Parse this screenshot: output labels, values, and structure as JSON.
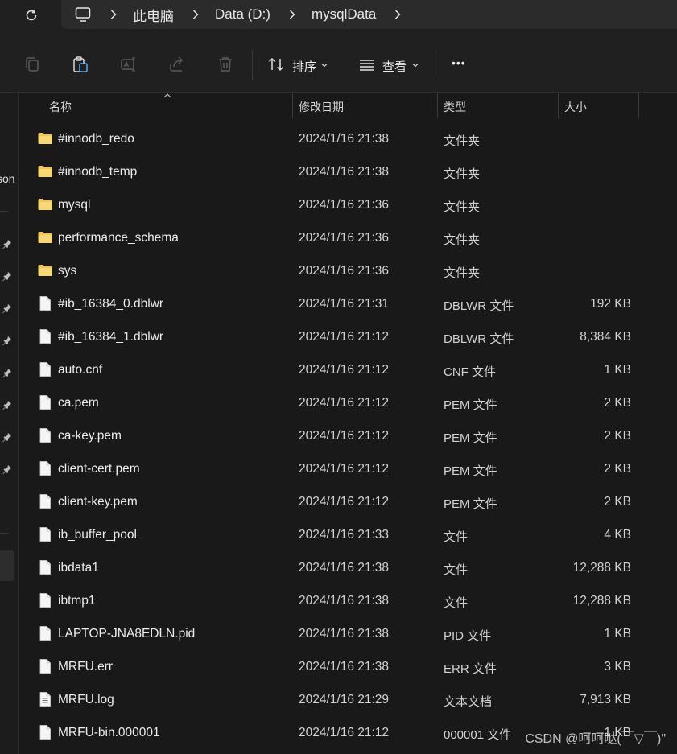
{
  "address": {
    "crumbs": [
      "此电脑",
      "Data (D:)",
      "mysqlData"
    ]
  },
  "toolbar": {
    "sort_label": "排序",
    "view_label": "查看",
    "more_label": "•••"
  },
  "nav": {
    "fragment": "son"
  },
  "columns": {
    "name": "名称",
    "date": "修改日期",
    "type": "类型",
    "size": "大小"
  },
  "files": [
    {
      "name": "#innodb_redo",
      "date": "2024/1/16 21:38",
      "type": "文件夹",
      "size": "",
      "kind": "folder"
    },
    {
      "name": "#innodb_temp",
      "date": "2024/1/16 21:38",
      "type": "文件夹",
      "size": "",
      "kind": "folder"
    },
    {
      "name": "mysql",
      "date": "2024/1/16 21:36",
      "type": "文件夹",
      "size": "",
      "kind": "folder"
    },
    {
      "name": "performance_schema",
      "date": "2024/1/16 21:36",
      "type": "文件夹",
      "size": "",
      "kind": "folder"
    },
    {
      "name": "sys",
      "date": "2024/1/16 21:36",
      "type": "文件夹",
      "size": "",
      "kind": "folder"
    },
    {
      "name": "#ib_16384_0.dblwr",
      "date": "2024/1/16 21:31",
      "type": "DBLWR 文件",
      "size": "192 KB",
      "kind": "file"
    },
    {
      "name": "#ib_16384_1.dblwr",
      "date": "2024/1/16 21:12",
      "type": "DBLWR 文件",
      "size": "8,384 KB",
      "kind": "file"
    },
    {
      "name": "auto.cnf",
      "date": "2024/1/16 21:12",
      "type": "CNF 文件",
      "size": "1 KB",
      "kind": "file"
    },
    {
      "name": "ca.pem",
      "date": "2024/1/16 21:12",
      "type": "PEM 文件",
      "size": "2 KB",
      "kind": "file"
    },
    {
      "name": "ca-key.pem",
      "date": "2024/1/16 21:12",
      "type": "PEM 文件",
      "size": "2 KB",
      "kind": "file"
    },
    {
      "name": "client-cert.pem",
      "date": "2024/1/16 21:12",
      "type": "PEM 文件",
      "size": "2 KB",
      "kind": "file"
    },
    {
      "name": "client-key.pem",
      "date": "2024/1/16 21:12",
      "type": "PEM 文件",
      "size": "2 KB",
      "kind": "file"
    },
    {
      "name": "ib_buffer_pool",
      "date": "2024/1/16 21:33",
      "type": "文件",
      "size": "4 KB",
      "kind": "file"
    },
    {
      "name": "ibdata1",
      "date": "2024/1/16 21:38",
      "type": "文件",
      "size": "12,288 KB",
      "kind": "file"
    },
    {
      "name": "ibtmp1",
      "date": "2024/1/16 21:38",
      "type": "文件",
      "size": "12,288 KB",
      "kind": "file"
    },
    {
      "name": "LAPTOP-JNA8EDLN.pid",
      "date": "2024/1/16 21:38",
      "type": "PID 文件",
      "size": "1 KB",
      "kind": "file"
    },
    {
      "name": "MRFU.err",
      "date": "2024/1/16 21:38",
      "type": "ERR 文件",
      "size": "3 KB",
      "kind": "file"
    },
    {
      "name": "MRFU.log",
      "date": "2024/1/16 21:29",
      "type": "文本文档",
      "size": "7,913 KB",
      "kind": "text"
    },
    {
      "name": "MRFU-bin.000001",
      "date": "2024/1/16 21:12",
      "type": "000001 文件",
      "size": "1 KB",
      "kind": "file"
    }
  ],
  "watermark": "CSDN @呵呵哒(￣▽￣)\"",
  "colors": {
    "background": "#191919",
    "bar": "#202020",
    "address": "#2b2b2b",
    "folder": "#f2c55c",
    "text": "#e4e4e4"
  }
}
